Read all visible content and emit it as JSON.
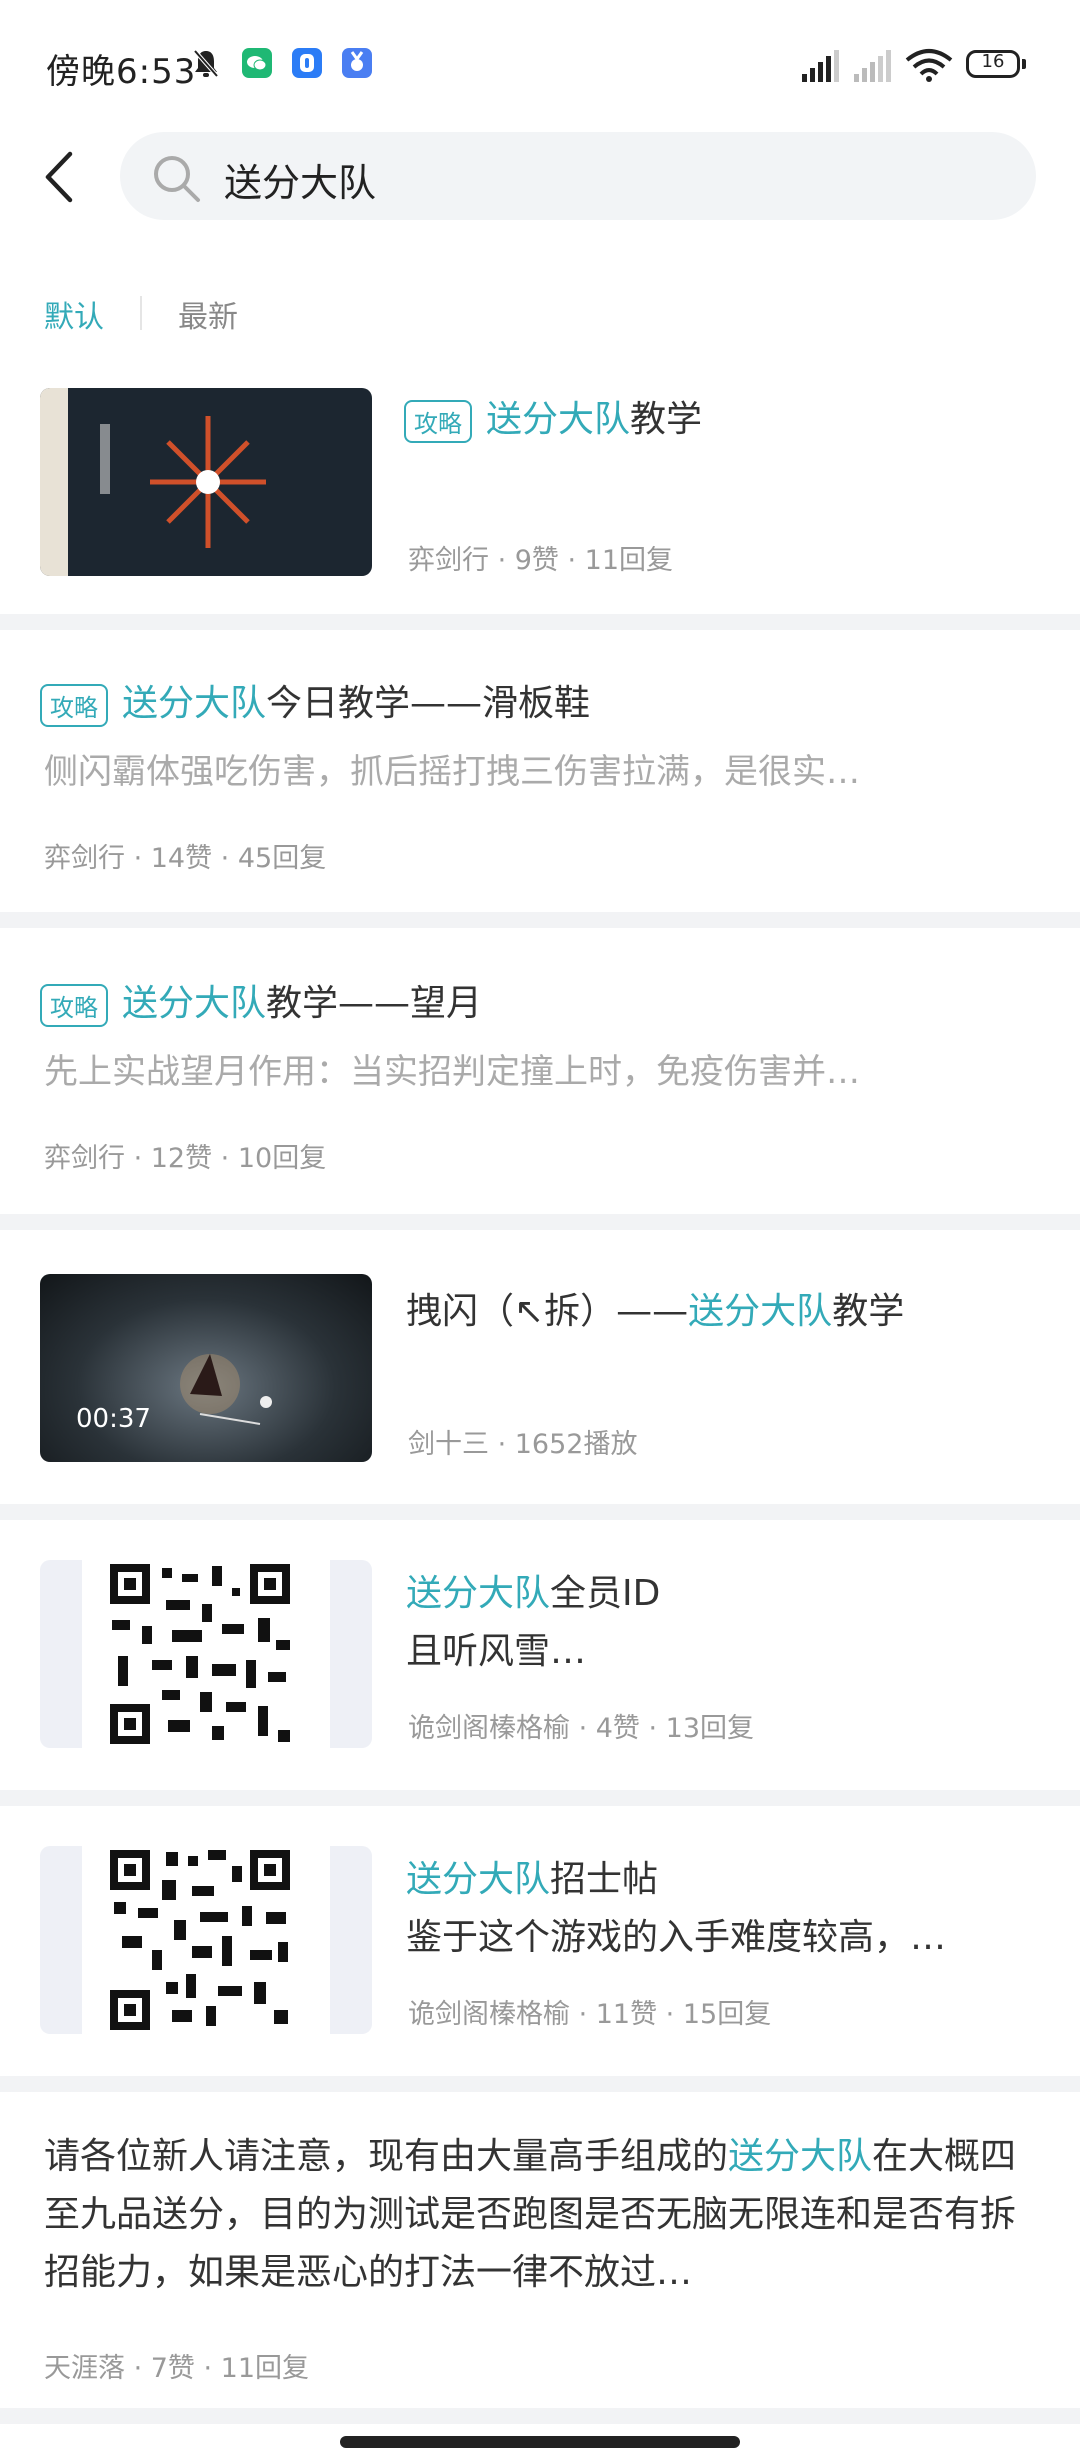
{
  "status_bar": {
    "time": "傍晚6:53",
    "battery": "16"
  },
  "search": {
    "query": "送分大队"
  },
  "sort": {
    "default_label": "默认",
    "newest_label": "最新"
  },
  "colors": {
    "accent": "#33aab8",
    "separator": "#f2f3f5"
  },
  "results": [
    {
      "tag": "攻略",
      "title_hl": "送分大队",
      "title_rest": "教学",
      "meta": "弈剑行 · 9赞 · 11回复",
      "thumb_icon": "skill-diagram-thumbnail"
    },
    {
      "tag": "攻略",
      "title_hl": "送分大队",
      "title_rest": "今日教学——滑板鞋",
      "snippet": "侧闪霸体强吃伤害，抓后摇打拽三伤害拉满，是很实…",
      "meta": "弈剑行 · 14赞 · 45回复"
    },
    {
      "tag": "攻略",
      "title_hl": "送分大队",
      "title_rest": "教学——望月",
      "snippet": "先上实战望月作用：当实招判定撞上时，免疫伤害并…",
      "meta": "弈剑行 · 12赞 · 10回复"
    },
    {
      "title_pre": "拽闪（↖拆）——",
      "title_hl": "送分大队",
      "title_rest": "教学",
      "duration": "00:37",
      "meta": "剑十三 · 1652播放",
      "thumb_icon": "video-thumbnail"
    },
    {
      "title_hl": "送分大队",
      "title_rest": "全员ID",
      "line2": "且听风雪…",
      "meta": "诡剑阁榛格榆 · 4赞 · 13回复",
      "thumb_icon": "qr-code-icon"
    },
    {
      "title_hl": "送分大队",
      "title_rest": "招士帖",
      "line2": "鉴于这个游戏的入手难度较高，…",
      "meta": "诡剑阁榛格榆 · 11赞 · 15回复",
      "thumb_icon": "qr-code-icon"
    },
    {
      "text_pre": "请各位新人请注意，现有由大量高手组成的",
      "text_hl": "送分大队",
      "text_post": "在大概四至九品送分，目的为测试是否跑图是否无脑无限连和是否有拆招能力，如果是恶心的打法一律不放过…",
      "meta": "天涯落 · 7赞 · 11回复"
    }
  ]
}
